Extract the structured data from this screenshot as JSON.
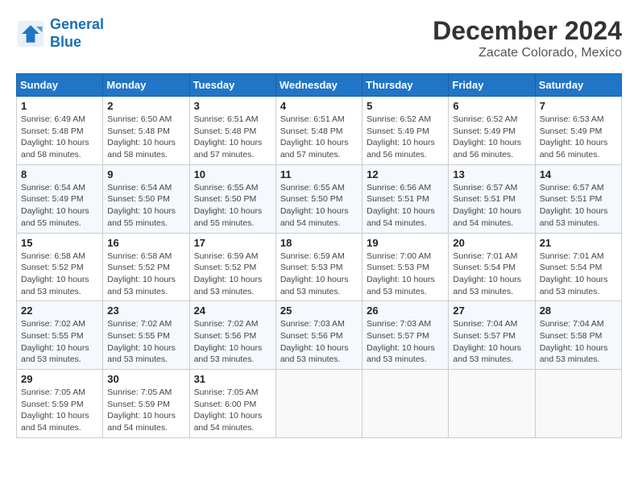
{
  "logo": {
    "line1": "General",
    "line2": "Blue"
  },
  "title": "December 2024",
  "location": "Zacate Colorado, Mexico",
  "days_of_week": [
    "Sunday",
    "Monday",
    "Tuesday",
    "Wednesday",
    "Thursday",
    "Friday",
    "Saturday"
  ],
  "weeks": [
    [
      {
        "day": "1",
        "sunrise": "6:49 AM",
        "sunset": "5:48 PM",
        "daylight": "10 hours and 58 minutes."
      },
      {
        "day": "2",
        "sunrise": "6:50 AM",
        "sunset": "5:48 PM",
        "daylight": "10 hours and 58 minutes."
      },
      {
        "day": "3",
        "sunrise": "6:51 AM",
        "sunset": "5:48 PM",
        "daylight": "10 hours and 57 minutes."
      },
      {
        "day": "4",
        "sunrise": "6:51 AM",
        "sunset": "5:48 PM",
        "daylight": "10 hours and 57 minutes."
      },
      {
        "day": "5",
        "sunrise": "6:52 AM",
        "sunset": "5:49 PM",
        "daylight": "10 hours and 56 minutes."
      },
      {
        "day": "6",
        "sunrise": "6:52 AM",
        "sunset": "5:49 PM",
        "daylight": "10 hours and 56 minutes."
      },
      {
        "day": "7",
        "sunrise": "6:53 AM",
        "sunset": "5:49 PM",
        "daylight": "10 hours and 56 minutes."
      }
    ],
    [
      {
        "day": "8",
        "sunrise": "6:54 AM",
        "sunset": "5:49 PM",
        "daylight": "10 hours and 55 minutes."
      },
      {
        "day": "9",
        "sunrise": "6:54 AM",
        "sunset": "5:50 PM",
        "daylight": "10 hours and 55 minutes."
      },
      {
        "day": "10",
        "sunrise": "6:55 AM",
        "sunset": "5:50 PM",
        "daylight": "10 hours and 55 minutes."
      },
      {
        "day": "11",
        "sunrise": "6:55 AM",
        "sunset": "5:50 PM",
        "daylight": "10 hours and 54 minutes."
      },
      {
        "day": "12",
        "sunrise": "6:56 AM",
        "sunset": "5:51 PM",
        "daylight": "10 hours and 54 minutes."
      },
      {
        "day": "13",
        "sunrise": "6:57 AM",
        "sunset": "5:51 PM",
        "daylight": "10 hours and 54 minutes."
      },
      {
        "day": "14",
        "sunrise": "6:57 AM",
        "sunset": "5:51 PM",
        "daylight": "10 hours and 53 minutes."
      }
    ],
    [
      {
        "day": "15",
        "sunrise": "6:58 AM",
        "sunset": "5:52 PM",
        "daylight": "10 hours and 53 minutes."
      },
      {
        "day": "16",
        "sunrise": "6:58 AM",
        "sunset": "5:52 PM",
        "daylight": "10 hours and 53 minutes."
      },
      {
        "day": "17",
        "sunrise": "6:59 AM",
        "sunset": "5:52 PM",
        "daylight": "10 hours and 53 minutes."
      },
      {
        "day": "18",
        "sunrise": "6:59 AM",
        "sunset": "5:53 PM",
        "daylight": "10 hours and 53 minutes."
      },
      {
        "day": "19",
        "sunrise": "7:00 AM",
        "sunset": "5:53 PM",
        "daylight": "10 hours and 53 minutes."
      },
      {
        "day": "20",
        "sunrise": "7:01 AM",
        "sunset": "5:54 PM",
        "daylight": "10 hours and 53 minutes."
      },
      {
        "day": "21",
        "sunrise": "7:01 AM",
        "sunset": "5:54 PM",
        "daylight": "10 hours and 53 minutes."
      }
    ],
    [
      {
        "day": "22",
        "sunrise": "7:02 AM",
        "sunset": "5:55 PM",
        "daylight": "10 hours and 53 minutes."
      },
      {
        "day": "23",
        "sunrise": "7:02 AM",
        "sunset": "5:55 PM",
        "daylight": "10 hours and 53 minutes."
      },
      {
        "day": "24",
        "sunrise": "7:02 AM",
        "sunset": "5:56 PM",
        "daylight": "10 hours and 53 minutes."
      },
      {
        "day": "25",
        "sunrise": "7:03 AM",
        "sunset": "5:56 PM",
        "daylight": "10 hours and 53 minutes."
      },
      {
        "day": "26",
        "sunrise": "7:03 AM",
        "sunset": "5:57 PM",
        "daylight": "10 hours and 53 minutes."
      },
      {
        "day": "27",
        "sunrise": "7:04 AM",
        "sunset": "5:57 PM",
        "daylight": "10 hours and 53 minutes."
      },
      {
        "day": "28",
        "sunrise": "7:04 AM",
        "sunset": "5:58 PM",
        "daylight": "10 hours and 53 minutes."
      }
    ],
    [
      {
        "day": "29",
        "sunrise": "7:05 AM",
        "sunset": "5:59 PM",
        "daylight": "10 hours and 54 minutes."
      },
      {
        "day": "30",
        "sunrise": "7:05 AM",
        "sunset": "5:59 PM",
        "daylight": "10 hours and 54 minutes."
      },
      {
        "day": "31",
        "sunrise": "7:05 AM",
        "sunset": "6:00 PM",
        "daylight": "10 hours and 54 minutes."
      },
      null,
      null,
      null,
      null
    ]
  ]
}
